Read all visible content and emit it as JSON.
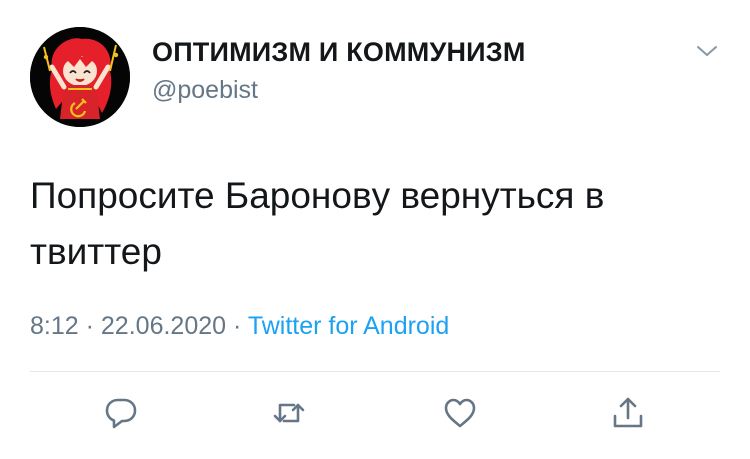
{
  "user": {
    "display_name": "ОПТИМИЗМ И КОММУНИЗМ",
    "handle": "@poebist",
    "avatar": "anime-girl-red-hair-hammer-sickle-avatar"
  },
  "tweet": {
    "text": "Попросите Бароновy вернуться в твиттер",
    "time": "8:12",
    "separator": "·",
    "date": "22.06.2020",
    "source": "Twitter for Android"
  },
  "actions": {
    "reply": "reply-icon",
    "retweet": "retweet-icon",
    "like": "heart-icon",
    "share": "share-icon"
  },
  "colors": {
    "text": "#14171a",
    "secondary": "#657786",
    "link": "#1da1f2",
    "divider": "#e1e8ed",
    "icon": "#657786"
  }
}
